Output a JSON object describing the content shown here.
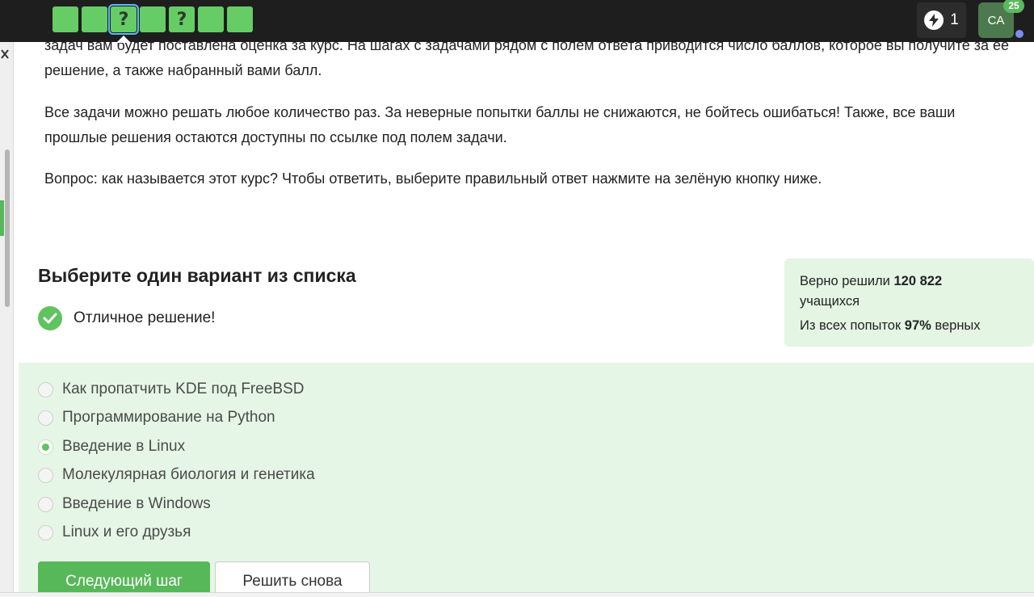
{
  "topbar": {
    "steps": [
      {
        "label": "",
        "status": "done"
      },
      {
        "label": "",
        "status": "done"
      },
      {
        "label": "?",
        "status": "current"
      },
      {
        "label": "",
        "status": "done"
      },
      {
        "label": "?",
        "status": "done"
      },
      {
        "label": "",
        "status": "done"
      },
      {
        "label": "",
        "status": "done"
      }
    ],
    "energy_count": "1",
    "avatar_initials": "CA",
    "avatar_badge": "25"
  },
  "lesson": {
    "paragraph_1": "задач вам будет поставлена оценка за курс. На шагах с задачами рядом с полем ответа приводится число баллов, которое вы получите за её решение, а также набранный вами балл.",
    "paragraph_2": "Все задачи можно решать любое количество раз. За неверные попытки баллы не снижаются, не бойтесь ошибаться! Также, все ваши прошлые решения остаются доступны по ссылке под полем задачи.",
    "paragraph_3": "Вопрос: как называется этот курс? Чтобы ответить, выберите правильный ответ нажмите на зелёную кнопку ниже."
  },
  "quiz": {
    "title": "Выберите один вариант из списка",
    "result_text": "Отличное решение!",
    "stats": {
      "solved_prefix": "Верно решили",
      "solved_count": "120 822",
      "solved_suffix": "учащихся",
      "attempts_prefix": "Из всех попыток",
      "attempts_percent": "97%",
      "attempts_suffix": "верных"
    },
    "options": [
      {
        "label": "Как пропатчить KDE под FreeBSD",
        "selected": false
      },
      {
        "label": "Программирование на Python",
        "selected": false
      },
      {
        "label": "Введение в Linux",
        "selected": true
      },
      {
        "label": "Молекулярная биология и генетика",
        "selected": false
      },
      {
        "label": "Введение в Windows",
        "selected": false
      },
      {
        "label": "Linux и его друзья",
        "selected": false
      }
    ],
    "next_button": "Следующий шаг",
    "retry_button": "Решить снова"
  },
  "colors": {
    "accent_green": "#56b858",
    "topbar_bg": "#1e1e1e",
    "answers_bg": "#e6f6e6"
  }
}
